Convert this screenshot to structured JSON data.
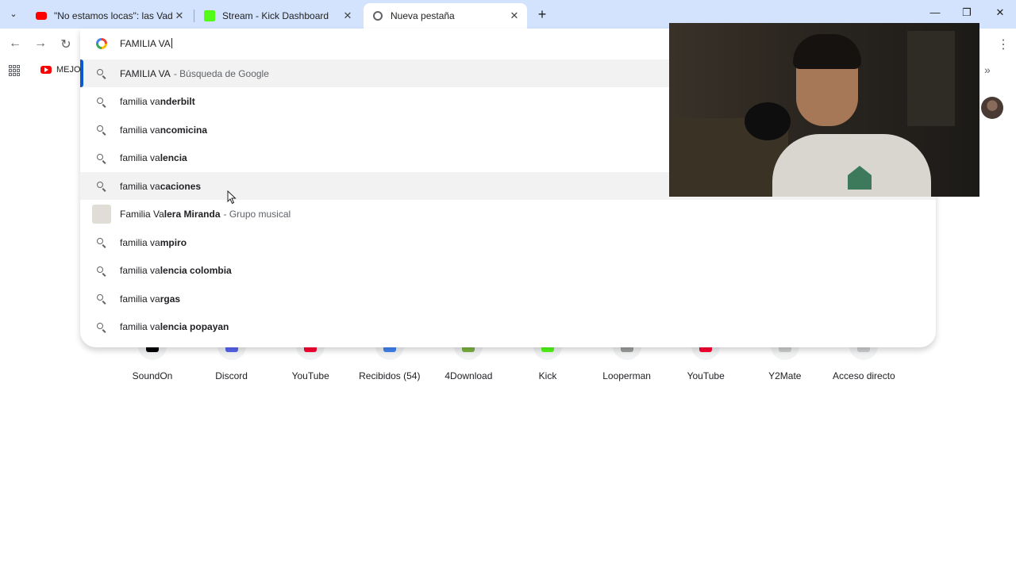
{
  "tabs": [
    {
      "title": "\"No estamos locas\": las Vadalá,",
      "favicon": "youtube-icon",
      "active": false
    },
    {
      "title": "Stream - Kick Dashboard",
      "favicon": "kick-icon",
      "active": false
    },
    {
      "title": "Nueva pestaña",
      "favicon": "chrome-icon",
      "active": true
    }
  ],
  "bookmarks": {
    "first_label": "MEJOR"
  },
  "omnibox": {
    "query": "FAMILIA VA",
    "suggestions": [
      {
        "prefix": "FAMILIA VA",
        "bold": "",
        "desc": "- Búsqueda de Google",
        "icon": "search-icon",
        "selected": true
      },
      {
        "prefix": "familia va",
        "bold": "nderbilt",
        "desc": "",
        "icon": "search-icon"
      },
      {
        "prefix": "familia va",
        "bold": "ncomicina",
        "desc": "",
        "icon": "search-icon"
      },
      {
        "prefix": "familia va",
        "bold": "lencia",
        "desc": "",
        "icon": "search-icon"
      },
      {
        "prefix": "familia va",
        "bold": "caciones",
        "desc": "",
        "icon": "search-icon",
        "hover": true
      },
      {
        "prefix": "Familia Va",
        "bold": "lera Miranda",
        "desc": "- Grupo musical",
        "icon": "entity-thumbnail"
      },
      {
        "prefix": "familia va",
        "bold": "mpiro",
        "desc": "",
        "icon": "search-icon"
      },
      {
        "prefix": "familia va",
        "bold": "lencia colombia",
        "desc": "",
        "icon": "search-icon"
      },
      {
        "prefix": "familia va",
        "bold": "rgas",
        "desc": "",
        "icon": "search-icon"
      },
      {
        "prefix": "familia va",
        "bold": "lencia popayan",
        "desc": "",
        "icon": "search-icon"
      }
    ]
  },
  "shortcuts": [
    {
      "label": "SoundOn",
      "color": "#000000"
    },
    {
      "label": "Discord",
      "color": "#5865f2"
    },
    {
      "label": "YouTube",
      "color": "#ff0033"
    },
    {
      "label": "Recibidos (54)",
      "color": "#4285f4"
    },
    {
      "label": "4Download",
      "color": "#7cb342"
    },
    {
      "label": "Kick",
      "color": "#53fc18"
    },
    {
      "label": "Looperman",
      "color": "#9e9e9e"
    },
    {
      "label": "YouTube",
      "color": "#ff0033"
    },
    {
      "label": "Y2Mate",
      "color": "#cfcfcf"
    },
    {
      "label": "Acceso directo",
      "color": "#cfcfcf"
    }
  ],
  "colors": {
    "accent": "#0b57d0",
    "tabstrip": "#d3e3fd"
  }
}
